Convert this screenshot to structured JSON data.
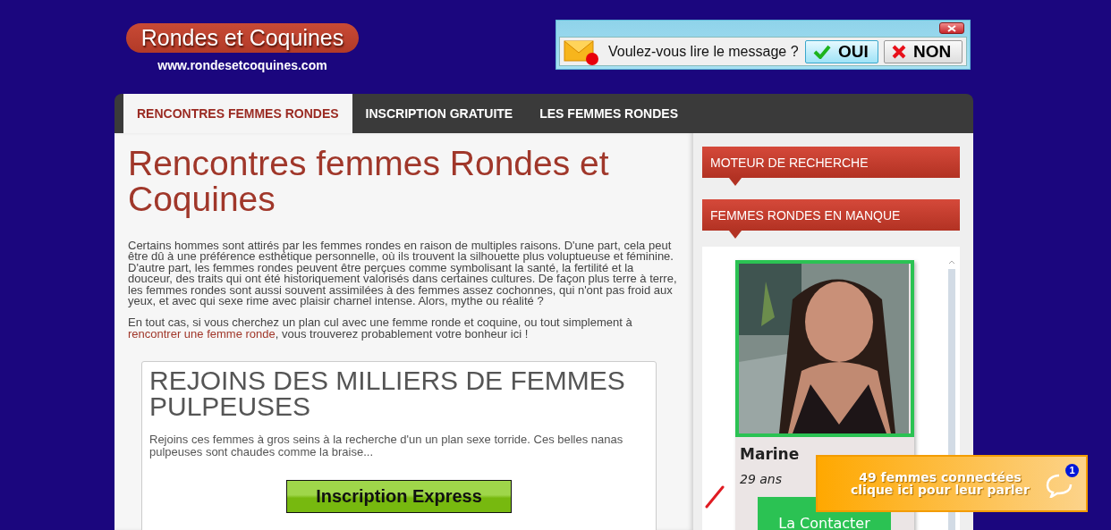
{
  "header": {
    "logo": "Rondes et Coquines",
    "url": "www.rondesetcoquines.com"
  },
  "message_popup": {
    "question": "Voulez-vous lire le message ?",
    "buttons": [
      {
        "label": "OUI",
        "kind": "yes"
      },
      {
        "label": "NON",
        "kind": "no"
      }
    ]
  },
  "nav": [
    {
      "label": "RENCONTRES FEMMES RONDES",
      "selected": true
    },
    {
      "label": "INSCRIPTION GRATUITE",
      "selected": false
    },
    {
      "label": "LES FEMMES RONDES",
      "selected": false
    }
  ],
  "main": {
    "title": "Rencontres femmes Rondes et Coquines",
    "paragraphs": [
      [
        {
          "text": "Certains hommes sont attirés par les femmes rondes en raison de multiples raisons. D'une part, cela peut être dû à une préférence esthétique personnelle, où ils trouvent la silhouette plus voluptueuse et féminine. D'autre part, les femmes rondes peuvent être perçues comme symbolisant la santé, la fertilité et la douceur, des traits qui ont été historiquement valorisés dans certaines cultures. De façon plus terre à terre, les femmes rondes sont aussi souvent assimilées à des femmes assez cochonnes, qui n'ont pas froid aux yeux, et avec qui sexe rime avec plaisir charnel intense. Alors, mythe ou réalité ?",
          "kind": "text"
        }
      ],
      [
        {
          "text": "En tout cas, si vous cherchez un plan cul avec une femme ronde et coquine, ou tout simplement à ",
          "kind": "text"
        },
        {
          "text": "rencontrer une femme ronde",
          "kind": "link"
        },
        {
          "text": ", vous trouverez probablement votre bonheur ici !",
          "kind": "text"
        }
      ]
    ],
    "join_box": {
      "title": "REJOINS DES MILLIERS DE FEMMES PULPEUSES",
      "text": "Rejoins ces femmes à gros seins à la recherche d'un un plan sexe torride. Ces belles nanas pulpeuses sont chaudes comme la braise...",
      "button": "Inscription Express"
    }
  },
  "sidebar": {
    "headings": [
      "MOTEUR DE RECHERCHE",
      "FEMMES RONDES EN MANQUE"
    ],
    "profile": {
      "name": "Marine",
      "age": "29 ans",
      "button": "La Contacter"
    }
  },
  "chat_popup": {
    "line1": "49 femmes connectées",
    "line2": "clique ici pour leur parler",
    "badge": "1"
  }
}
